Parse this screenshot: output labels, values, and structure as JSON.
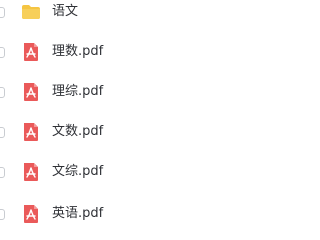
{
  "files": [
    {
      "name": "语文",
      "type": "folder",
      "icon": "folder-icon"
    },
    {
      "name": "理数.pdf",
      "type": "pdf",
      "icon": "pdf-icon"
    },
    {
      "name": "理综.pdf",
      "type": "pdf",
      "icon": "pdf-icon"
    },
    {
      "name": "文数.pdf",
      "type": "pdf",
      "icon": "pdf-icon"
    },
    {
      "name": "文综.pdf",
      "type": "pdf",
      "icon": "pdf-icon"
    },
    {
      "name": "英语.pdf",
      "type": "pdf",
      "icon": "pdf-icon"
    }
  ],
  "colors": {
    "folder": "#f5c542",
    "pdf": "#ea5a5a",
    "text": "#2f3136",
    "checkbox_border": "#c9ccd1"
  }
}
